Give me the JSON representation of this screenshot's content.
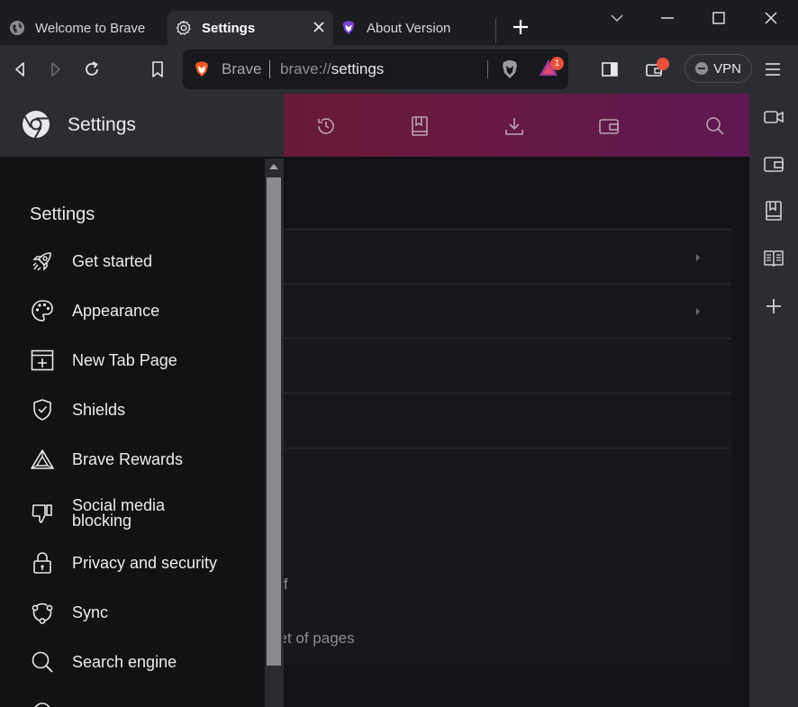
{
  "tabs": [
    {
      "title": "Welcome to Brave",
      "icon": "globe-icon",
      "active": false
    },
    {
      "title": "Settings",
      "icon": "gear-icon",
      "active": true
    },
    {
      "title": "About Version",
      "icon": "brave-lion-icon",
      "active": false
    }
  ],
  "omnibox": {
    "site_label": "Brave",
    "url_scheme": "brave://",
    "url_path": "settings",
    "rewards_badge": "1"
  },
  "vpn": {
    "label": "VPN"
  },
  "drawer": {
    "header_title": "Settings",
    "heading": "Settings",
    "items": [
      {
        "label": "Get started",
        "icon": "rocket-icon"
      },
      {
        "label": "Appearance",
        "icon": "palette-icon"
      },
      {
        "label": "New Tab Page",
        "icon": "new-tab-icon"
      },
      {
        "label": "Shields",
        "icon": "shield-icon"
      },
      {
        "label": "Brave Rewards",
        "icon": "rewards-triangle-icon"
      },
      {
        "label": "Social media blocking",
        "icon": "thumbs-down-icon"
      },
      {
        "label": "Privacy and security",
        "icon": "lock-icon"
      },
      {
        "label": "Sync",
        "icon": "sync-icon"
      },
      {
        "label": "Search engine",
        "icon": "search-icon"
      }
    ]
  },
  "page": {
    "partial_text_1": "off",
    "partial_text_2": "set of pages"
  },
  "colors": {
    "accent_gradient_start": "#4a1a34",
    "accent_gradient_end": "#5f1852",
    "badge": "#e8513a"
  }
}
